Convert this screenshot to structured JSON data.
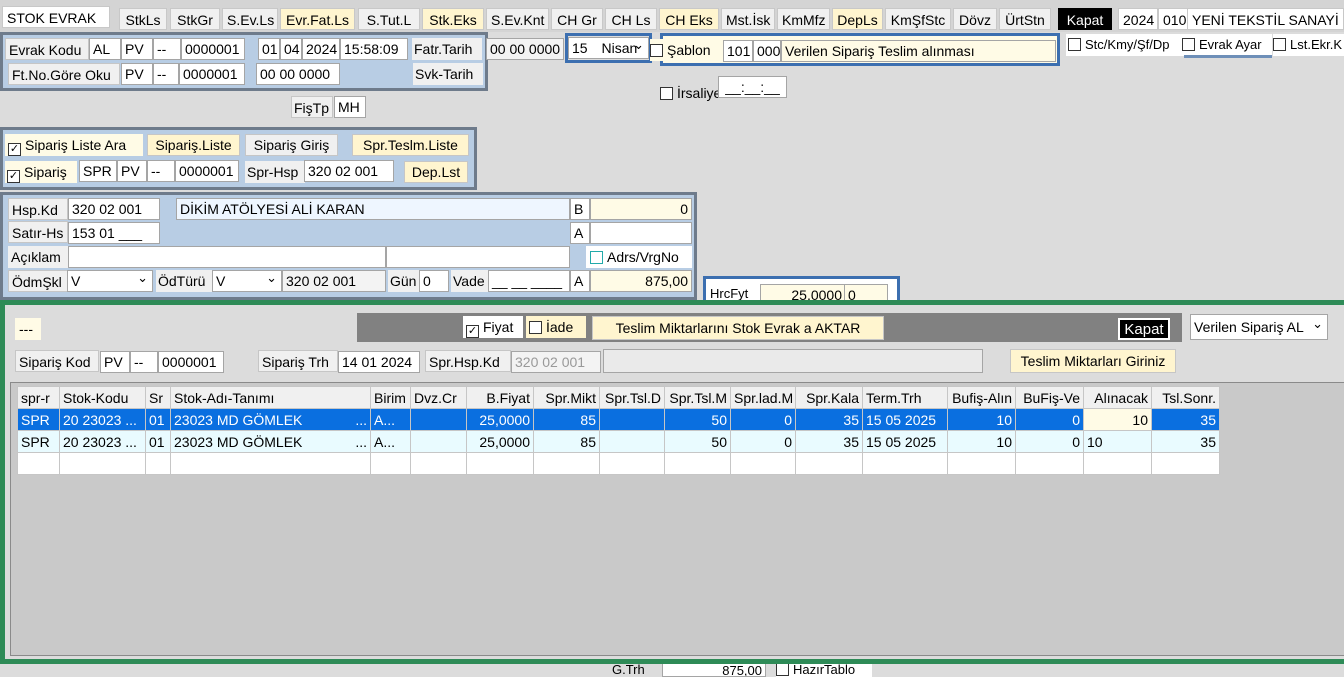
{
  "toolbar": {
    "title": "STOK EVRAK",
    "buttons": [
      "StkLs",
      "StkGr",
      "S.Ev.Ls",
      "Evr.Fat.Ls",
      "S.Tut.L",
      "Stk.Eks",
      "S.Ev.Knt",
      "CH Gr",
      "CH Ls",
      "CH Eks",
      "Mst.İsk",
      "KmMfz",
      "DepLs",
      "KmŞfStc",
      "Dövz",
      "ÜrtStn"
    ],
    "close": "Kapat",
    "year": "2024",
    "company_code": "010",
    "company_name": "YENİ TEKSTİL SANAYİ"
  },
  "header": {
    "evrak_kodu_label": "Evrak Kodu",
    "evrak_type": "AL",
    "evrak_series": "PV",
    "evrak_dash": "--",
    "evrak_no": "0000001",
    "day": "01",
    "month": "04",
    "year": "2024",
    "time": "15:58:09",
    "fatr_tarih_label": "Fatr.Tarih",
    "fatr_tarih": "00 00 0000",
    "day_select": "15",
    "month_select": "Nisan",
    "ft_no_label": "Ft.No.Göre Oku",
    "ft_series": "PV",
    "ft_dash": "--",
    "ft_no": "0000001",
    "ft_date": "00 00 0000",
    "svk_tarih_label": "Svk-Tarih",
    "fistp_label": "FişTp",
    "fistp_value": "MH"
  },
  "sablon": {
    "label": "Şablon",
    "code1": "101",
    "code2": "000",
    "text": "Verilen Sipariş Teslim alınması"
  },
  "options": {
    "stc_label": "Stc/Kmy/Şf/Dp",
    "evrak_ayar": "Evrak Ayar",
    "lst_ekr": "Lst.Ekr.K",
    "irsaliye_label": "İrsaliye",
    "irsaliye_value": "__:__:__"
  },
  "siparis": {
    "liste_ara": "Sipariş Liste Ara",
    "liste_btn": "Sipariş.Liste",
    "giris_btn": "Sipariş Giriş",
    "teslim_liste_btn": "Spr.Teslm.Liste",
    "siparis_label": "Sipariş",
    "code": "SPR",
    "series": "PV",
    "dash": "--",
    "no": "0000001",
    "spr_hsp_label": "Spr-Hsp",
    "spr_hsp": "320 02 001",
    "dep_lst": "Dep.Lst"
  },
  "account": {
    "hsp_kd_label": "Hsp.Kd",
    "hsp_kd": "320 02 001",
    "hsp_name": "DİKİM  ATÖLYESİ  ALİ KARAN",
    "b_label": "B",
    "b_value": "0",
    "satir_hs_label": "Satır-Hs",
    "satir_hs": "153 01 ___",
    "a_label": "A",
    "aciklama_label": "Açıklam",
    "adrs_label": "Adrs/VrgNo",
    "odm_label": "ÖdmŞkl",
    "odm_value": "V",
    "odturu_label": "ÖdTürü",
    "odturu_value": "V",
    "odturu_acct": "320 02 001",
    "gun_label": "Gün",
    "gun_value": "0",
    "vade_label": "Vade",
    "vade_value": "__ __ ____",
    "a2_label": "A",
    "total": "875,00",
    "hrc_label": "HrcFyt",
    "hrc_value": "25,0000",
    "hrc_zero": "0"
  },
  "panel": {
    "dash": "---",
    "fiyat_label": "Fiyat",
    "iade_label": "İade",
    "aktar_btn": "Teslim Miktarlarını Stok Evrak a AKTAR",
    "close": "Kapat",
    "mode_select": "Verilen Sipariş AL",
    "siparis_kod_label": "Sipariş Kod",
    "sk_series": "PV",
    "sk_dash": "--",
    "sk_no": "0000001",
    "siparis_trh_label": "Sipariş Trh",
    "siparis_trh": "14 01 2024",
    "spr_hsp_kd_label": "Spr.Hsp.Kd",
    "spr_hsp_kd": "320 02 001",
    "teslim_btn": "Teslim Miktarları Giriniz"
  },
  "grid": {
    "headers": [
      "spr-r",
      "Stok-Kodu",
      "Sr",
      "Stok-Adı-Tanımı",
      "Birim",
      "Dvz.Cr",
      "B.Fiyat",
      "Spr.Mikt",
      "Spr.Tsl.D",
      "Spr.Tsl.M",
      "Spr.lad.M",
      "Spr.Kala",
      "Term.Trh",
      "Bufiş-Alın",
      "BuFiş-Ve",
      "Alınacak",
      "Tsl.Sonr."
    ],
    "rows": [
      [
        "SPR",
        "20 23023 ...",
        "01",
        "23023 MD GÖMLEK",
        "A...",
        "",
        "25,0000",
        "85",
        "",
        "50",
        "0",
        "35",
        "15 05 2025",
        "10",
        "0",
        "10",
        "35"
      ],
      [
        "SPR",
        "20 23023 ...",
        "01",
        "23023 MD GÖMLEK",
        "A...",
        "",
        "25,0000",
        "85",
        "",
        "50",
        "0",
        "35",
        "15 05 2025",
        "10",
        "0",
        "10",
        "35"
      ]
    ],
    "name_suffix": "..."
  },
  "bottom": {
    "g_trh_label": "G.Trh",
    "g_trh_value": "875,00",
    "hazir_label": "HazırTablo"
  },
  "colors": {
    "selected_row": "#0a6fe0",
    "panel_border": "#2e8b57",
    "frame_border": "#6e7b8b",
    "close_bg": "#000000"
  }
}
